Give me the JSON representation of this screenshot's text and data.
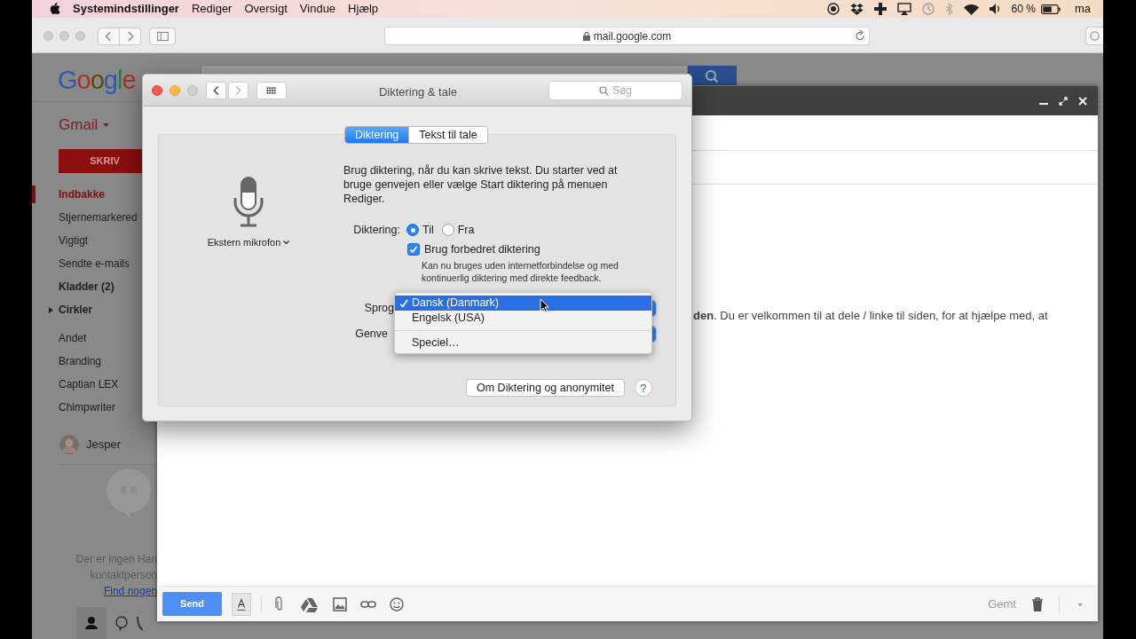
{
  "menu_bar": {
    "app": "Systemindstillinger",
    "menus": [
      "Rediger",
      "Oversigt",
      "Vindue",
      "Hjælp"
    ],
    "battery_text": "60 %",
    "clock": "ma"
  },
  "browser": {
    "address": "mail.google.com"
  },
  "gmail": {
    "logo": "Google",
    "app_menu": "Gmail",
    "compose_button": "SKRIV",
    "folders": [
      {
        "label": "Indbakke",
        "selected": true,
        "bold": false,
        "kind": "folder"
      },
      {
        "label": "Stjernemarkered",
        "selected": false,
        "bold": false,
        "kind": "folder"
      },
      {
        "label": "Vigtigt",
        "selected": false,
        "bold": false,
        "kind": "folder"
      },
      {
        "label": "Sendte e-mails",
        "selected": false,
        "bold": false,
        "kind": "folder"
      },
      {
        "label": "Kladder (2)",
        "selected": false,
        "bold": true,
        "kind": "folder"
      },
      {
        "label": "Cirkler",
        "selected": false,
        "bold": true,
        "kind": "group",
        "expanded": false
      },
      {
        "label": "Andet",
        "selected": false,
        "bold": false,
        "kind": "folder"
      },
      {
        "label": "Branding",
        "selected": false,
        "bold": false,
        "kind": "folder"
      },
      {
        "label": "Captian LEX",
        "selected": false,
        "bold": false,
        "kind": "folder"
      },
      {
        "label": "Chimpwriter",
        "selected": false,
        "bold": false,
        "kind": "folder"
      }
    ],
    "user": "Jesper",
    "hangouts_empty": [
      "Der er ingen Han",
      "kontaktperson"
    ],
    "hangouts_link": "Find nogen"
  },
  "compose": {
    "body_text": "**den**. Du er velkommen til at dele / linke til siden, for at hjælpe med, at",
    "send": "Send",
    "saved": "Gemt"
  },
  "dialog": {
    "title": "Diktering & tale",
    "search_placeholder": "Søg",
    "tabs": [
      {
        "label": "Diktering",
        "selected": true
      },
      {
        "label": "Tekst til tale",
        "selected": false
      }
    ],
    "microphone": "Ekstern mikrofon",
    "description": "Brug diktering, når du kan skrive tekst. Du starter ved at bruge genvejen eller vælge Start diktering på menuen Rediger.",
    "dictation_label": "Diktering:",
    "radios": [
      {
        "label": "Til",
        "selected": true
      },
      {
        "label": "Fra",
        "selected": false
      }
    ],
    "enhanced": {
      "label": "Brug forbedret diktering",
      "checked": true,
      "note": "Kan nu bruges uden internetforbindelse og med kontinuerlig diktering med direkte feedback."
    },
    "language_label": "Sprog",
    "shortcut_label": "Genve",
    "language_menu": [
      {
        "label": "Dansk (Danmark)",
        "selected": true,
        "checked": true,
        "separator_before": false
      },
      {
        "label": "Engelsk (USA)",
        "selected": false,
        "checked": false,
        "separator_before": false
      },
      {
        "label": "Speciel…",
        "selected": false,
        "checked": false,
        "separator_before": true
      }
    ],
    "about_button": "Om Diktering og anonymitet",
    "help": "?"
  }
}
